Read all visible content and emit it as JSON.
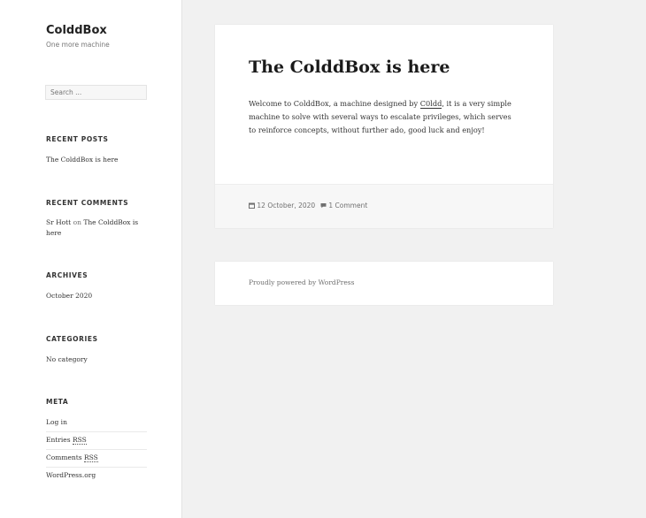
{
  "site": {
    "title": "ColddBox",
    "description": "One more machine"
  },
  "search": {
    "placeholder": "Search ..."
  },
  "widgets": {
    "recent_posts": {
      "title": "RECENT POSTS",
      "items": [
        "The ColddBox is here"
      ]
    },
    "recent_comments": {
      "title": "RECENT COMMENTS",
      "author": "Sr Hott",
      "on": "on",
      "post": "The ColddBox is here"
    },
    "archives": {
      "title": "ARCHIVES",
      "items": [
        "October 2020"
      ]
    },
    "categories": {
      "title": "CATEGORIES",
      "items": [
        "No category"
      ]
    },
    "meta": {
      "title": "META",
      "login": "Log in",
      "entries_prefix": "Entries",
      "entries_abbr": "RSS",
      "comments_prefix": "Comments",
      "comments_abbr": "RSS",
      "wordpress": "WordPress.org"
    }
  },
  "post": {
    "title": "The ColddBox is here",
    "body_before_link": "Welcome to ColddBox, a machine designed by",
    "author_link": "C0ldd",
    "body_after_link": ", it is a very simple machine to solve with several ways to escalate privileges, which serves to reinforce concepts, without further ado, good luck and enjoy!",
    "date": "12 October, 2020",
    "comments": "1 Comment"
  },
  "footer": {
    "text": "Proudly powered by WordPress"
  },
  "colors": {
    "background": "#f1f1f1",
    "sidebar": "#ffffff",
    "card": "#ffffff",
    "muted": "#707070"
  }
}
